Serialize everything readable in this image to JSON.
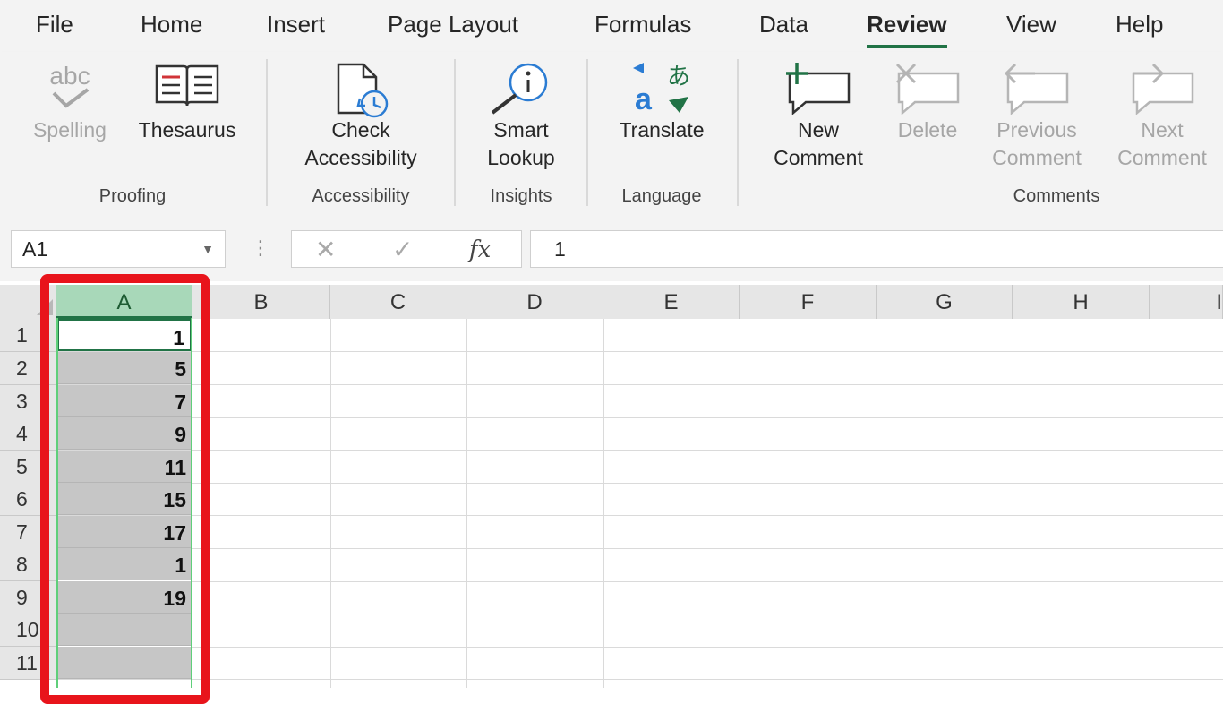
{
  "menu": {
    "tabs": [
      {
        "label": "File"
      },
      {
        "label": "Home"
      },
      {
        "label": "Insert"
      },
      {
        "label": "Page Layout"
      },
      {
        "label": "Formulas"
      },
      {
        "label": "Data"
      },
      {
        "label": "Review",
        "active": true
      },
      {
        "label": "View"
      },
      {
        "label": "Help"
      }
    ]
  },
  "ribbon": {
    "buttons": {
      "spelling": {
        "label": "Spelling",
        "icon": "spelling-abc-icon",
        "disabled": true
      },
      "thesaurus": {
        "label": "Thesaurus",
        "icon": "book-icon"
      },
      "check_accessibility": {
        "line1": "Check",
        "line2": "Accessibility",
        "icon": "accessibility-check-icon"
      },
      "smart_lookup": {
        "line1": "Smart",
        "line2": "Lookup",
        "icon": "magnifier-info-icon"
      },
      "translate": {
        "label": "Translate",
        "icon": "translate-icon"
      },
      "new_comment": {
        "line1": "New",
        "line2": "Comment",
        "icon": "new-comment-icon"
      },
      "delete": {
        "label": "Delete",
        "icon": "delete-comment-icon",
        "disabled": true
      },
      "previous_comment": {
        "line1": "Previous",
        "line2": "Comment",
        "icon": "previous-comment-icon",
        "disabled": true
      },
      "next_comment": {
        "line1": "Next",
        "line2": "Comment",
        "icon": "next-comment-icon",
        "disabled": true
      }
    },
    "groups": {
      "proofing": "Proofing",
      "accessibility": "Accessibility",
      "insights": "Insights",
      "language": "Language",
      "comments": "Comments"
    }
  },
  "formula_bar": {
    "name_box": "A1",
    "cancel_symbol": "✕",
    "enter_symbol": "✓",
    "fx_label": "fx",
    "value": "1"
  },
  "sheet": {
    "columns": [
      "A",
      "B",
      "C",
      "D",
      "E",
      "F",
      "G",
      "H",
      "I"
    ],
    "selected_column": "A",
    "rows": [
      "1",
      "2",
      "3",
      "4",
      "5",
      "6",
      "7",
      "8",
      "9",
      "10",
      "11"
    ],
    "column_a_values": [
      "1",
      "5",
      "7",
      "9",
      "11",
      "15",
      "17",
      "1",
      "19",
      "",
      ""
    ],
    "active_cell": "A1"
  },
  "colors": {
    "accent": "#217346",
    "highlight_box": "#e8141b",
    "selected_header": "#a8d8b9"
  }
}
